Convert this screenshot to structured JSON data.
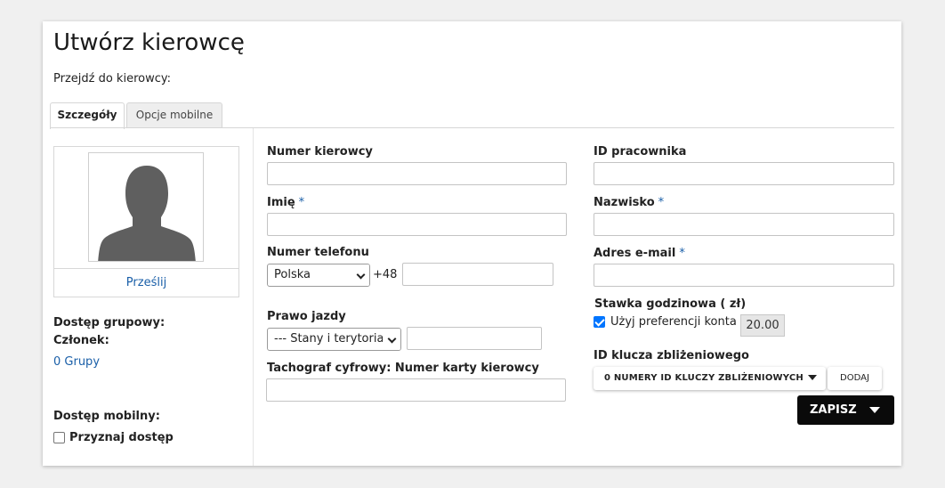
{
  "page": {
    "title": "Utwórz kierowcę",
    "goto_label": "Przejdź do kierowcy:"
  },
  "tabs": [
    {
      "label": "Szczegóły",
      "active": true
    },
    {
      "label": "Opcje mobilne",
      "active": false
    }
  ],
  "left": {
    "upload_link": "Prześlij",
    "group_access_label": "Dostęp grupowy:",
    "member_label": "Członek:",
    "groups_link": "0 Grupy",
    "mobile_access_label": "Dostęp mobilny:",
    "grant_access_label": "Przyznaj dostęp",
    "grant_access_checked": false
  },
  "form": {
    "driver_number_label": "Numer kierowcy",
    "driver_number_value": "",
    "first_name_label": "Imię",
    "first_name_value": "",
    "phone_label": "Numer telefonu",
    "phone_country": "Polska",
    "phone_prefix": "+48",
    "phone_value": "",
    "license_label": "Prawo jazdy",
    "license_state": "--- Stany i terytoria U",
    "license_value": "",
    "tacho_label": "Tachograf cyfrowy: Numer karty kierowcy",
    "tacho_value": "",
    "employee_id_label": "ID pracownika",
    "employee_id_value": "",
    "last_name_label": "Nazwisko",
    "last_name_value": "",
    "email_label": "Adres e-mail",
    "email_value": "",
    "hourly_rate_label": "Stawka godzinowa ( zł)",
    "use_account_pref_label": "Użyj preferencji konta",
    "use_account_pref_checked": true,
    "hourly_rate_value": "20.00",
    "proximity_label": "ID klucza zbliżeniowego",
    "proximity_button": "0 NUMERY ID KLUCZY ZBLIŻENIOWYCH",
    "add_button": "DODAJ",
    "required_marker": "*"
  },
  "save_button": "ZAPISZ",
  "icons": {
    "avatar": "person-silhouette-icon",
    "dropdown": "caret-down-icon",
    "select": "chevron-down-icon"
  }
}
